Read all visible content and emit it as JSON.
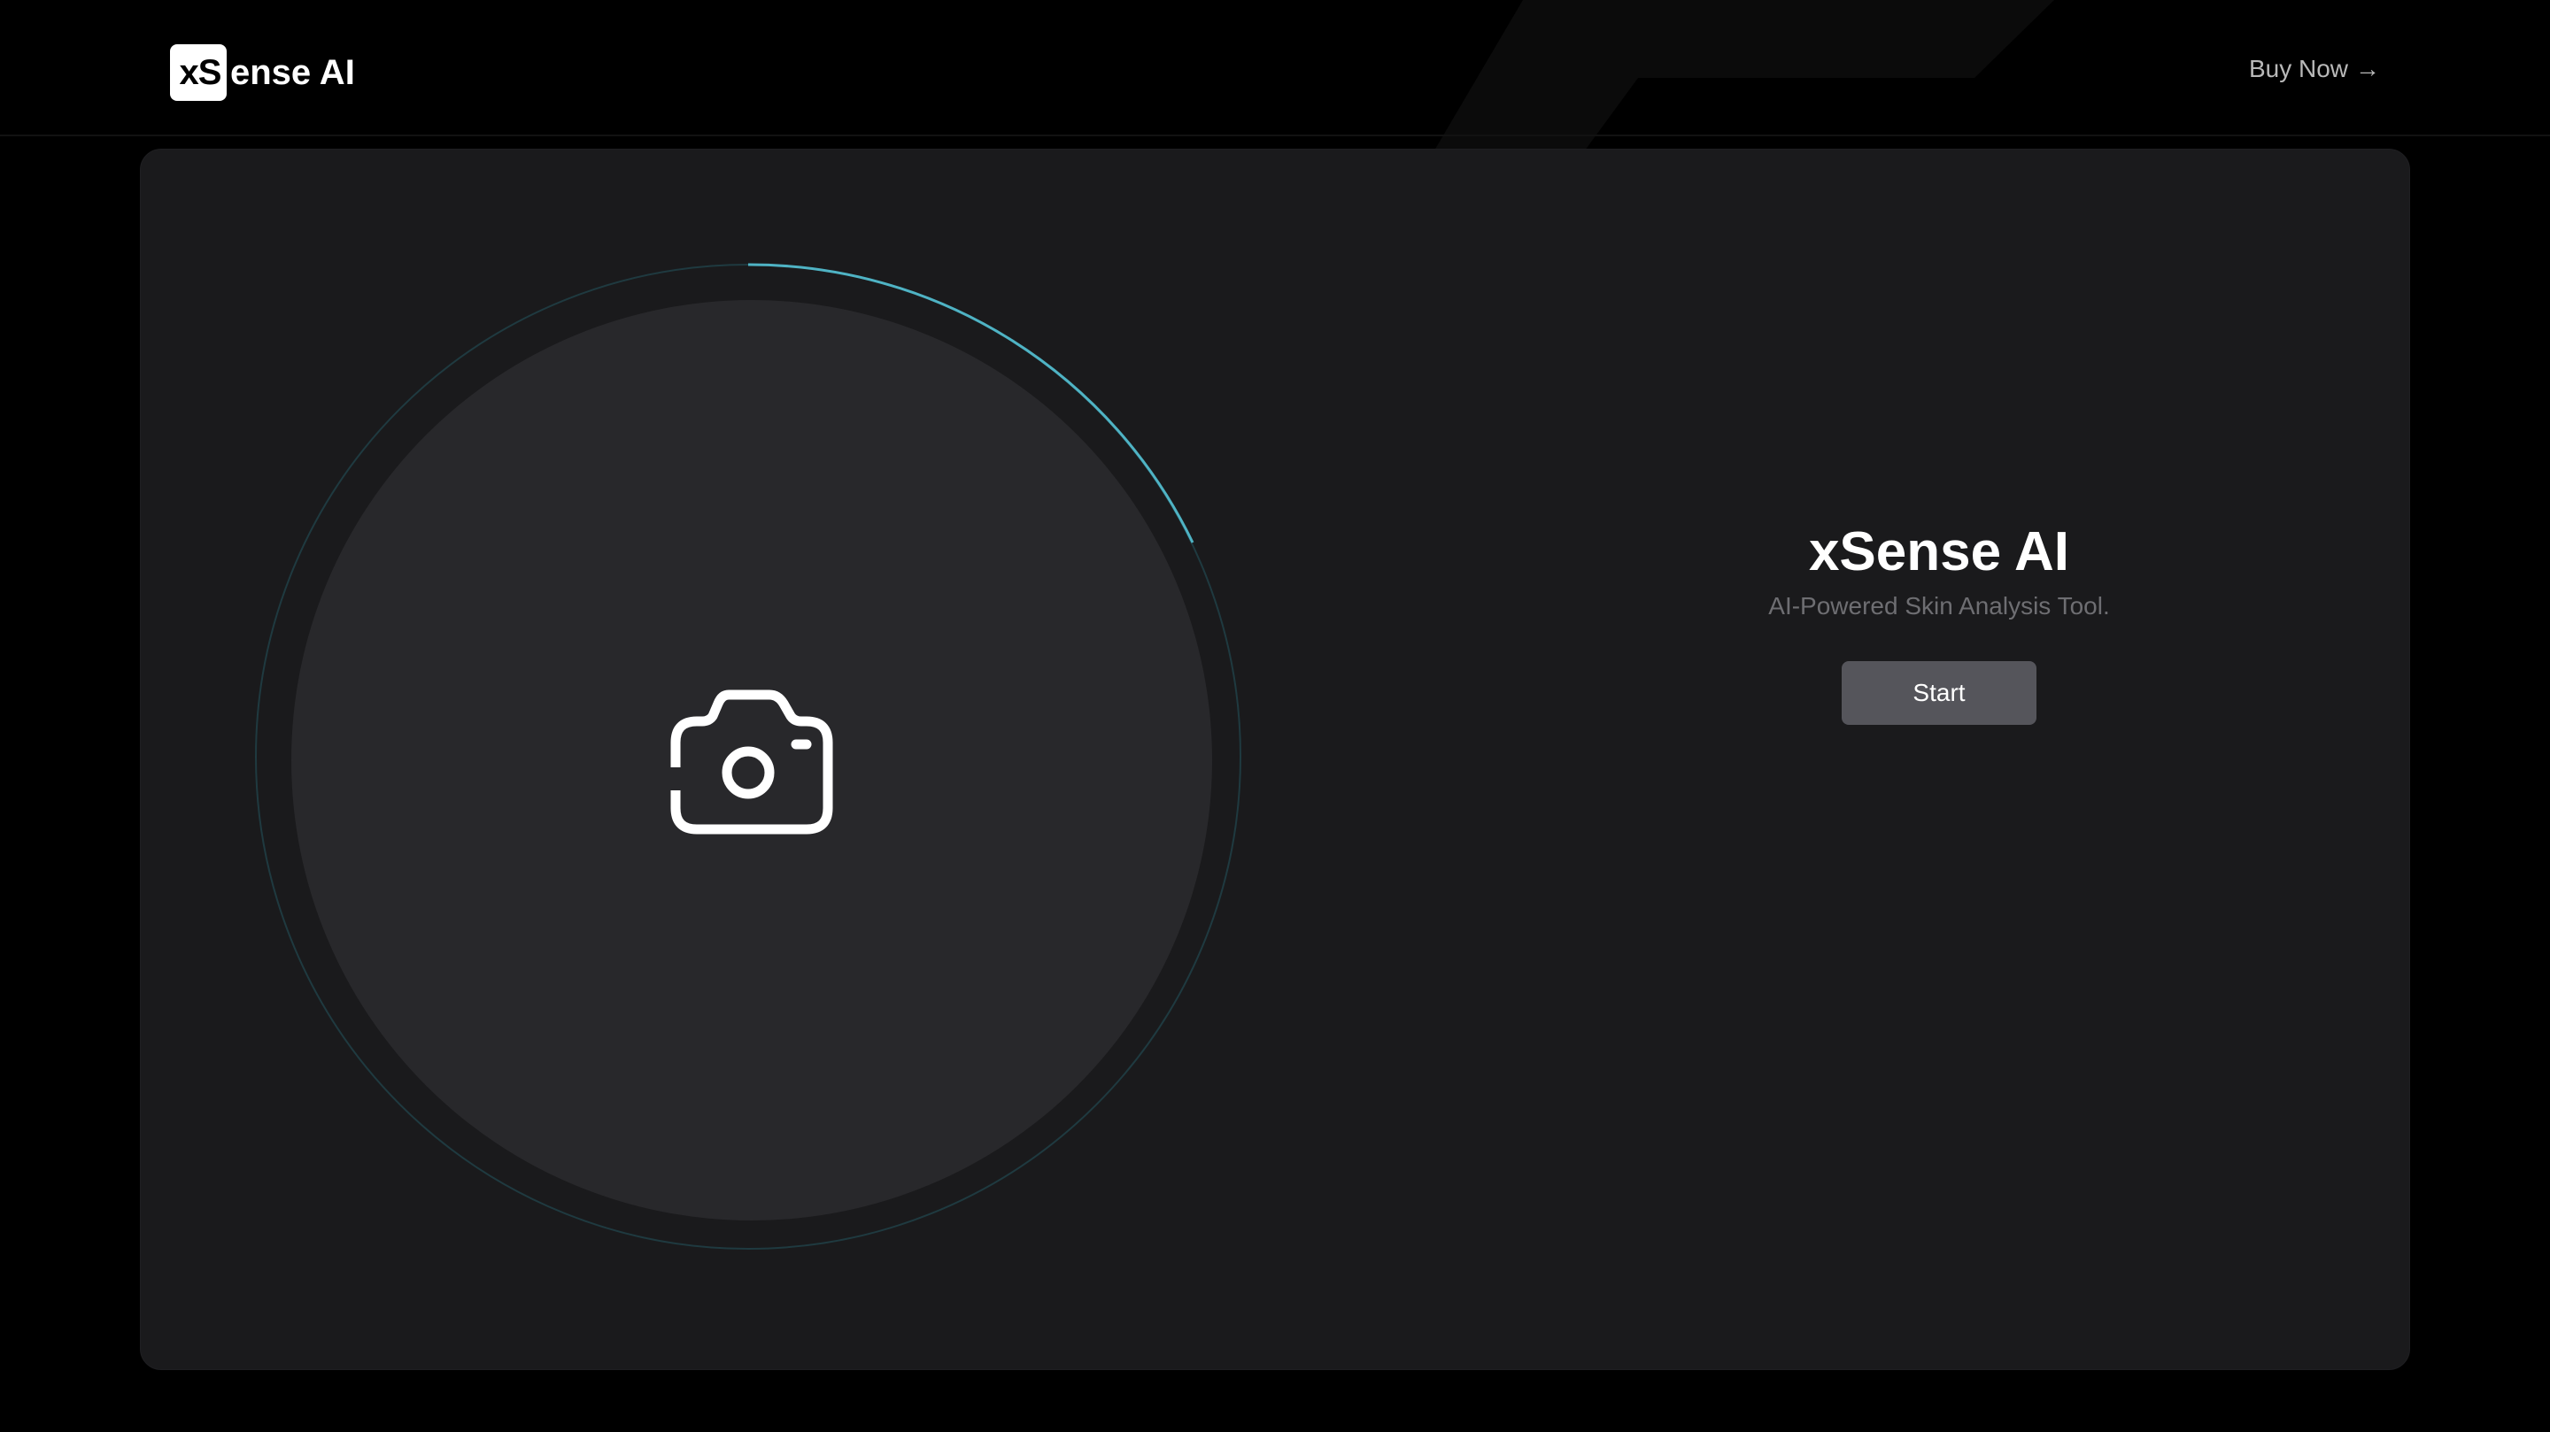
{
  "header": {
    "logo_box_text": "xS",
    "logo_rest_text": "ense AI",
    "buy_now_label": "Buy Now",
    "buy_now_arrow": "→"
  },
  "capture": {
    "icon": "camera-icon",
    "ring_accent_color": "#4fb3c4",
    "ring_base_color": "#1f3a40"
  },
  "hero": {
    "title": "xSense AI",
    "subtitle": "AI-Powered Skin Analysis Tool.",
    "start_label": "Start"
  },
  "colors": {
    "background": "#000000",
    "card": "#1a1a1c",
    "circle": "#28282b",
    "button": "#55555b"
  }
}
